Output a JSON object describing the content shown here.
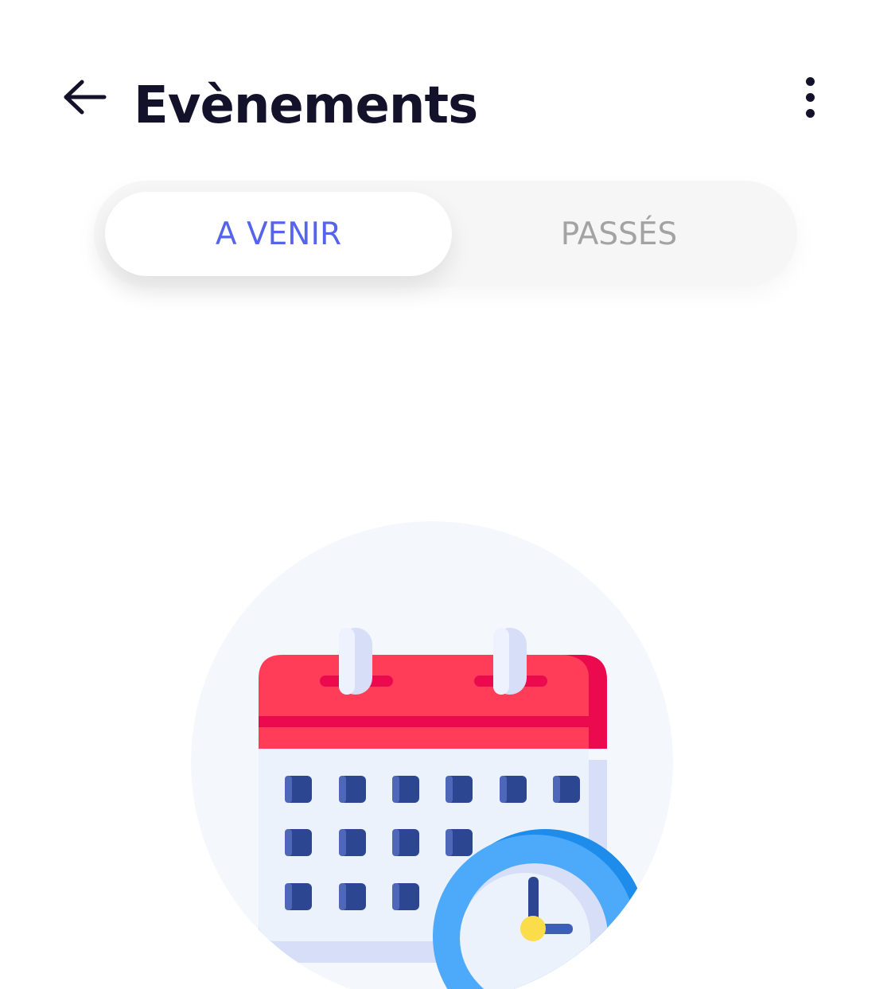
{
  "header": {
    "title": "Evènements",
    "back_icon": "arrow-left-icon",
    "more_icon": "more-vertical-icon"
  },
  "tabs": [
    {
      "label": "A VENIR",
      "active": true
    },
    {
      "label": "PASSÉS",
      "active": false
    }
  ],
  "empty_state": {
    "illustration_icon": "calendar-clock-icon"
  },
  "colors": {
    "accent": "#5564ea",
    "title": "#14122b",
    "inactive_tab": "#a3a3a3",
    "calendar_red": "#ff3d58",
    "calendar_dark_red": "#ea0a4d",
    "calendar_square": "#2d4691",
    "clock_blue": "#4da9f9"
  }
}
